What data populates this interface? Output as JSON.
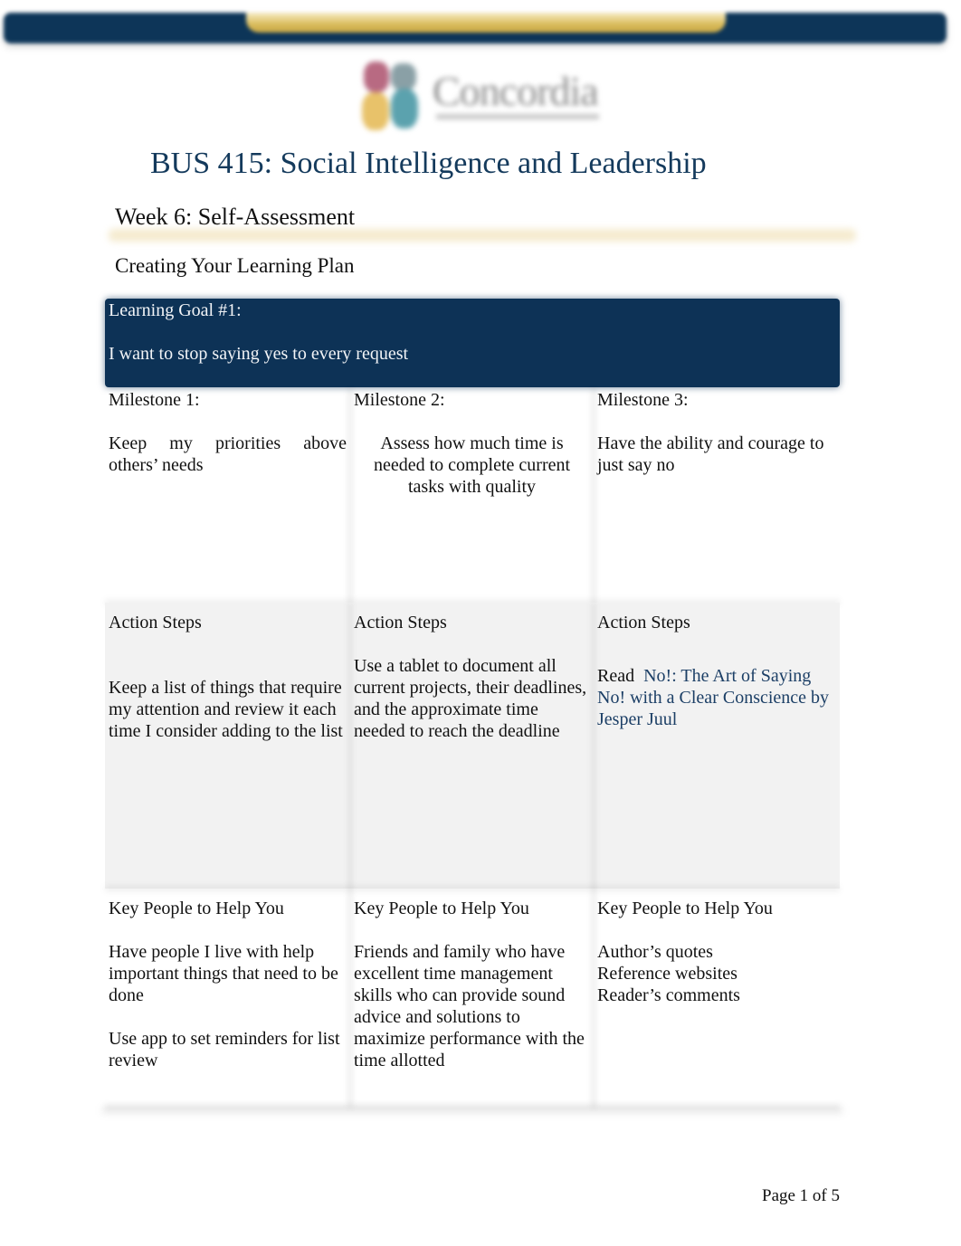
{
  "header": {
    "logo_text": "Concordia",
    "course_title": "BUS 415: Social Intelligence and Leadership",
    "week_title": "Week 6: Self-Assessment",
    "section_title": "Creating Your Learning Plan",
    "colors": {
      "navy": "#0d3256",
      "gold": "#d9bb5a",
      "title_blue": "#143a5c",
      "link_blue": "#1c3f66"
    }
  },
  "goal": {
    "label": "Learning Goal #1:",
    "text": "I want to stop saying yes to every request"
  },
  "milestones": [
    {
      "label": "Milestone 1:",
      "text": "Keep my priorities above others’ needs"
    },
    {
      "label": "Milestone 2:",
      "text": "Assess how much time is needed to complete current tasks with quality"
    },
    {
      "label": "Milestone 3:",
      "text": "Have the ability and courage to just say no"
    }
  ],
  "action_steps": [
    {
      "label": "Action Steps",
      "text": "Keep a list of things that require my attention and review it each time I consider adding to the list"
    },
    {
      "label": "Action Steps",
      "text": "Use a tablet to document all current projects, their deadlines, and the approximate time needed to reach the deadline"
    },
    {
      "label": "Action Steps",
      "prefix": "Read",
      "book": "No!: The Art of Saying No! with a Clear Conscience by Jesper Juul"
    }
  ],
  "key_people": [
    {
      "label": "Key People to Help You",
      "paragraphs": [
        "Have people I live with help important things that need to be done",
        "Use app to set reminders for list review"
      ]
    },
    {
      "label": "Key People to Help You",
      "paragraphs": [
        "Friends and family who have excellent time management skills who can provide sound advice and solutions to maximize performance with the time allotted"
      ]
    },
    {
      "label": "Key People to Help You",
      "lines": [
        "Author’s quotes",
        "Reference websites",
        "Reader’s comments"
      ]
    }
  ],
  "footer": {
    "page_label": "Page 1 of 5"
  }
}
